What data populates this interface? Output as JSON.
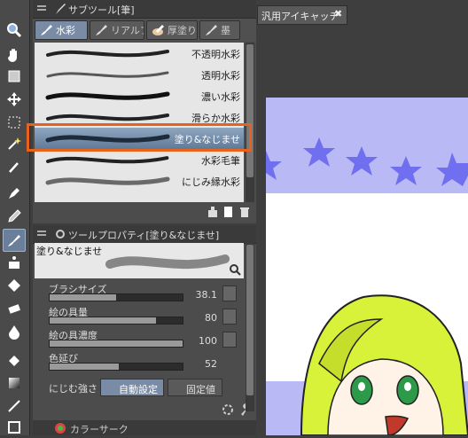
{
  "subtool_panel": {
    "title": "サブツール[筆]",
    "tabs": [
      {
        "label": "水彩",
        "active": true
      },
      {
        "label": "リアルフ",
        "active": false
      },
      {
        "label": "厚塗り",
        "active": false
      },
      {
        "label": "墨",
        "active": false
      }
    ],
    "brushes": [
      {
        "name": "不透明水彩",
        "selected": false
      },
      {
        "name": "透明水彩",
        "selected": false
      },
      {
        "name": "濃い水彩",
        "selected": false
      },
      {
        "name": "滑らか水彩",
        "selected": false
      },
      {
        "name": "塗り&なじませ",
        "selected": true
      },
      {
        "name": "水彩毛筆",
        "selected": false
      },
      {
        "name": "にじみ縁水彩",
        "selected": false
      }
    ]
  },
  "property_panel": {
    "title": "ツールプロパティ[塗り&なじませ]",
    "preview_label": "塗り&なじませ",
    "properties": [
      {
        "label": "ブラシサイズ",
        "value": "38.1",
        "level": 0.5
      },
      {
        "label": "絵の具量",
        "value": "80",
        "level": 0.8
      },
      {
        "label": "絵の具濃度",
        "value": "100",
        "level": 1.0
      },
      {
        "label": "色延び",
        "value": "52",
        "level": 0.52
      }
    ],
    "blend_label": "にじむ強さ",
    "blend_options": [
      "自動設定",
      "固定値"
    ]
  },
  "bottom_tab": {
    "label": "カラーサーク"
  },
  "canvas": {
    "tab_label": "汎用アイキャッチ"
  },
  "colors": {
    "accent": "#e8621a",
    "panel": "#4c4c4c",
    "band": "#b9b9f5",
    "star": "#6f6ff0",
    "hair": "#d8f23a"
  }
}
